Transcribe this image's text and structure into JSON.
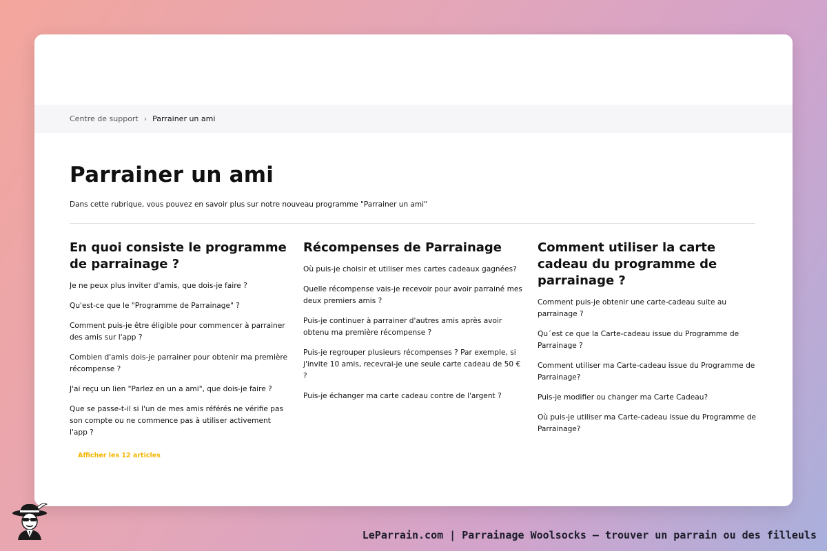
{
  "breadcrumb": {
    "root": "Centre de support",
    "separator": "›",
    "current": "Parrainer un ami"
  },
  "page": {
    "title": "Parrainer un ami",
    "subtitle": "Dans cette rubrique, vous pouvez en savoir plus sur notre nouveau programme \"Parrainer un ami\""
  },
  "sections": [
    {
      "title": "En quoi consiste le programme de parrainage ?",
      "articles": [
        "Je ne peux plus inviter d'amis, que dois-je faire ?",
        "Qu'est-ce que le \"Programme de Parrainage\" ?",
        "Comment puis-je être éligible pour commencer à parrainer des amis sur l'app ?",
        "Combien d'amis dois-je parrainer pour obtenir ma première récompense ?",
        "J'ai reçu un lien \"Parlez en un a ami\", que dois-je faire ?",
        "Que se passe-t-il si l'un de mes amis référés ne vérifie pas son compte ou ne commence pas à utiliser activement l'app ?"
      ],
      "more_link": "Afficher les 12 articles"
    },
    {
      "title": "Récompenses de Parrainage",
      "articles": [
        "Où puis-je choisir et utiliser mes cartes cadeaux gagnées?",
        "Quelle récompense vais-je recevoir pour avoir parrainé mes deux premiers amis ?",
        "Puis-je continuer à parrainer d'autres amis après avoir obtenu ma première récompense ?",
        "Puis-je regrouper plusieurs récompenses ? Par exemple, si j'invite 10 amis, recevrai-je une seule carte cadeau de 50 € ?",
        "Puis-je échanger ma carte cadeau contre de l'argent ?"
      ]
    },
    {
      "title": "Comment utiliser la carte cadeau du programme de parrainage ?",
      "articles": [
        "Comment puis-je obtenir une carte-cadeau suite au parrainage ?",
        "Qu´est ce que la Carte-cadeau issue du Programme de Parrainage ?",
        "Comment utiliser ma Carte-cadeau issue du Programme de Parrainage?",
        "Puis-je modifier ou changer ma Carte Cadeau?",
        "Où puis-je utiliser ma Carte-cadeau issue du Programme de Parrainage?"
      ]
    }
  ],
  "footer": {
    "text": "LeParrain.com | Parrainage Woolsocks — trouver un parrain ou des filleuls"
  },
  "colors": {
    "accent_link": "#f5b400",
    "breadcrumb_bg": "#f6f6f8"
  },
  "icons": {
    "logo": "mascot-logo-icon"
  }
}
